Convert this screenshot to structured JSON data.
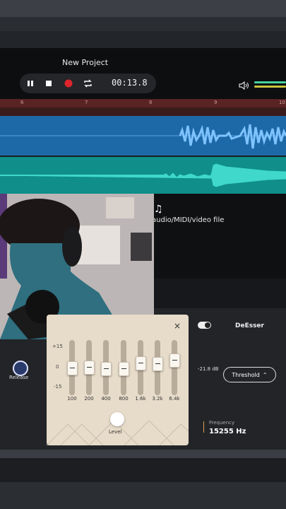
{
  "app": {
    "title": "New Project"
  },
  "transport": {
    "time": "00:13.8"
  },
  "ruler": {
    "ticks": [
      "6",
      "7",
      "8",
      "9",
      "10"
    ]
  },
  "drop_area": {
    "text": "audio/MIDI/video file"
  },
  "eq": {
    "db_labels": [
      "+15",
      "0",
      "-15"
    ],
    "bands": [
      "100",
      "200",
      "400",
      "800",
      "1.6k",
      "3.2k",
      "6.4k"
    ],
    "band_levels": [
      0.5,
      0.48,
      0.52,
      0.52,
      0.38,
      0.4,
      0.32
    ],
    "level_label": "Level",
    "close": "×"
  },
  "compressor": {
    "release_label": "Release"
  },
  "deesser": {
    "title": "DeEsser",
    "db_readout": "-21.8 dB",
    "threshold_label": "Threshold",
    "frequency_label": "Frequency",
    "frequency_value": "15255 Hz"
  },
  "colors": {
    "track_audio": "#1d69a8",
    "track_audio2": "#0f8e8a",
    "record": "#e0242c"
  }
}
